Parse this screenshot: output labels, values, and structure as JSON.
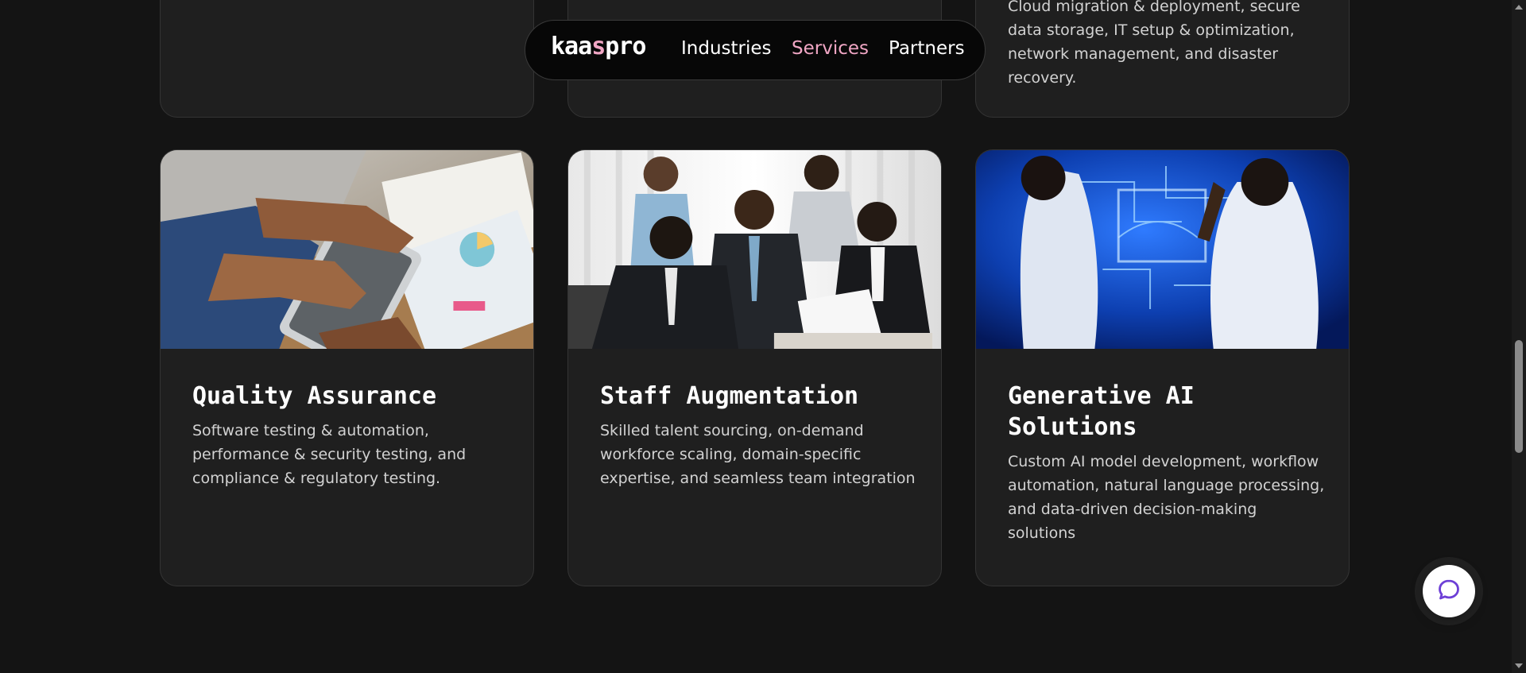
{
  "nav": {
    "logo_prefix": "kaa",
    "logo_accent": "s",
    "logo_suffix": "pro",
    "links": [
      "Industries",
      "Services",
      "Partners"
    ],
    "active_link": "Services"
  },
  "top_cards": [
    {
      "description": ""
    },
    {
      "description": ""
    },
    {
      "description": "Cloud migration & deployment, secure data storage, IT setup & optimization, network management, and disaster recovery."
    }
  ],
  "cards": [
    {
      "title": "Quality Assurance",
      "description": "Software testing & automation, performance & security testing, and compliance & regulatory testing.",
      "image": "team-reviewing-tablet-charts"
    },
    {
      "title": "Staff Augmentation",
      "description": "Skilled talent sourcing, on-demand workforce scaling, domain-specific expertise, and seamless team integration",
      "image": "business-team-meeting"
    },
    {
      "title": "Generative AI Solutions",
      "description": "Custom AI model development, workflow automation, natural language processing, and data-driven decision-making solutions",
      "image": "scientists-ai-circuit-screen"
    }
  ],
  "chat_button": {
    "icon": "chat-bubble-icon"
  },
  "colors": {
    "background": "#141414",
    "card": "#1f1f1f",
    "card_border": "#343434",
    "accent_pink": "#f0a6c4",
    "chat_icon": "#6d3fd6"
  }
}
